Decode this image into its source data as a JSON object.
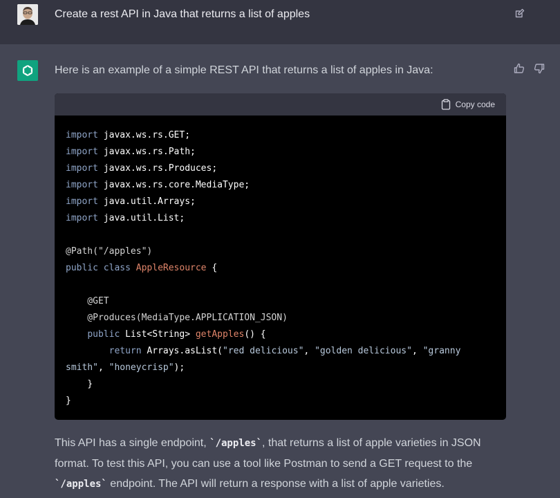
{
  "user_message": {
    "text": "Create a rest API in Java that returns a list of apples"
  },
  "assistant": {
    "intro": "Here is an example of a simple REST API that returns a list of apples in Java:",
    "code_block": {
      "copy_label": "Copy code",
      "lines": [
        [
          {
            "t": "import",
            "c": "kw"
          },
          {
            "t": " javax.ws.rs.GET;",
            "c": ""
          }
        ],
        [
          {
            "t": "import",
            "c": "kw"
          },
          {
            "t": " javax.ws.rs.Path;",
            "c": ""
          }
        ],
        [
          {
            "t": "import",
            "c": "kw"
          },
          {
            "t": " javax.ws.rs.Produces;",
            "c": ""
          }
        ],
        [
          {
            "t": "import",
            "c": "kw"
          },
          {
            "t": " javax.ws.rs.core.MediaType;",
            "c": ""
          }
        ],
        [
          {
            "t": "import",
            "c": "kw"
          },
          {
            "t": " java.util.Arrays;",
            "c": ""
          }
        ],
        [
          {
            "t": "import",
            "c": "kw"
          },
          {
            "t": " java.util.List;",
            "c": ""
          }
        ],
        [],
        [
          {
            "t": "@Path(\"/apples\")",
            "c": "ann"
          }
        ],
        [
          {
            "t": "public",
            "c": "kw"
          },
          {
            "t": " ",
            "c": ""
          },
          {
            "t": "class",
            "c": "kw"
          },
          {
            "t": " ",
            "c": ""
          },
          {
            "t": "AppleResource",
            "c": "cls"
          },
          {
            "t": " {",
            "c": ""
          }
        ],
        [],
        [
          {
            "t": "    @GET",
            "c": "ann"
          }
        ],
        [
          {
            "t": "    @Produces(MediaType.APPLICATION_JSON)",
            "c": "ann"
          }
        ],
        [
          {
            "t": "    ",
            "c": ""
          },
          {
            "t": "public",
            "c": "kw"
          },
          {
            "t": " List<String> ",
            "c": ""
          },
          {
            "t": "getApples",
            "c": "fn"
          },
          {
            "t": "() {",
            "c": ""
          }
        ],
        [
          {
            "t": "        ",
            "c": ""
          },
          {
            "t": "return",
            "c": "kw"
          },
          {
            "t": " Arrays.asList(",
            "c": ""
          },
          {
            "t": "\"red delicious\"",
            "c": "str"
          },
          {
            "t": ", ",
            "c": ""
          },
          {
            "t": "\"golden delicious\"",
            "c": "str"
          },
          {
            "t": ", ",
            "c": ""
          },
          {
            "t": "\"granny",
            "c": "str"
          }
        ],
        [
          {
            "t": "smith\"",
            "c": "str"
          },
          {
            "t": ", ",
            "c": ""
          },
          {
            "t": "\"honeycrisp\"",
            "c": "str"
          },
          {
            "t": ");",
            "c": ""
          }
        ],
        [
          {
            "t": "    }",
            "c": ""
          }
        ],
        [
          {
            "t": "}",
            "c": ""
          }
        ]
      ]
    },
    "explanation": [
      {
        "t": "This API has a single endpoint, ",
        "k": "text"
      },
      {
        "t": "`/apples`",
        "k": "code"
      },
      {
        "t": ", that returns a list of apple varieties in JSON format. To test this API, you can use a tool like Postman to send a GET request to the ",
        "k": "text"
      },
      {
        "t": "`/apples`",
        "k": "code"
      },
      {
        "t": " endpoint. The API will return a response with a list of apple varieties.",
        "k": "text"
      }
    ]
  },
  "icons": {
    "edit": "edit-icon",
    "copy": "clipboard-icon",
    "like": "thumbs-up-icon",
    "dislike": "thumbs-down-icon",
    "assistant_logo": "openai-logo-icon"
  },
  "colors": {
    "user_bg": "#343541",
    "assistant_bg": "#444654",
    "code_bg": "#000000",
    "logo_bg": "#10a37f"
  }
}
